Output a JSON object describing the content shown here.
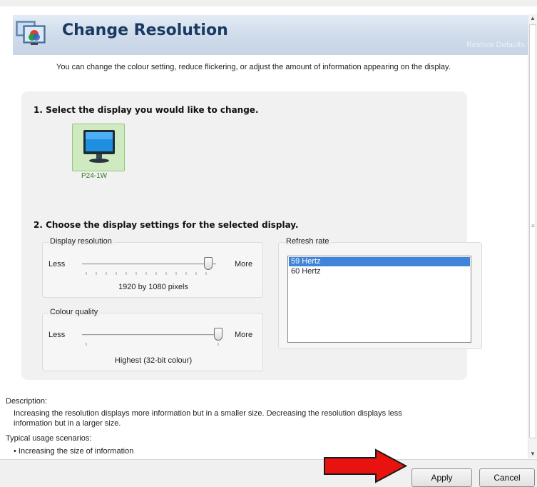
{
  "header": {
    "title": "Change Resolution",
    "restore_defaults": "Restore Defaults"
  },
  "intro": "You can change the colour setting, reduce flickering, or adjust the amount of information appearing on the display.",
  "step1": {
    "heading": "1. Select the display you would like to change.",
    "displays": [
      {
        "label": "P24-1W",
        "selected": true
      }
    ]
  },
  "step2": {
    "heading": "2. Choose the display settings for the selected display.",
    "resolution": {
      "title": "Display resolution",
      "less": "Less",
      "more": "More",
      "value_text": "1920 by 1080 pixels",
      "slider_position": 1.0
    },
    "colour": {
      "title": "Colour quality",
      "less": "Less",
      "more": "More",
      "value_text": "Highest (32-bit colour)",
      "slider_position": 1.0
    },
    "refresh": {
      "title": "Refresh rate",
      "options": [
        "59 Hertz",
        "60 Hertz"
      ],
      "selected": "59 Hertz"
    }
  },
  "description": {
    "label": "Description:",
    "text_line1": "Increasing the resolution displays more information but in a smaller size. Decreasing the resolution displays less",
    "text_line2": "information but in a larger size.",
    "usage_label": "Typical usage scenarios:",
    "usage_item": "• Increasing the size of information"
  },
  "buttons": {
    "apply": "Apply",
    "cancel": "Cancel"
  },
  "colors": {
    "title": "#1b3a63",
    "selection": "#3f84d8",
    "annotation_arrow": "#e8130f",
    "monitor_tile": "#cfe9c1"
  },
  "icons": [
    "display-settings-icon",
    "monitor-icon",
    "arrow-annotation-icon"
  ]
}
